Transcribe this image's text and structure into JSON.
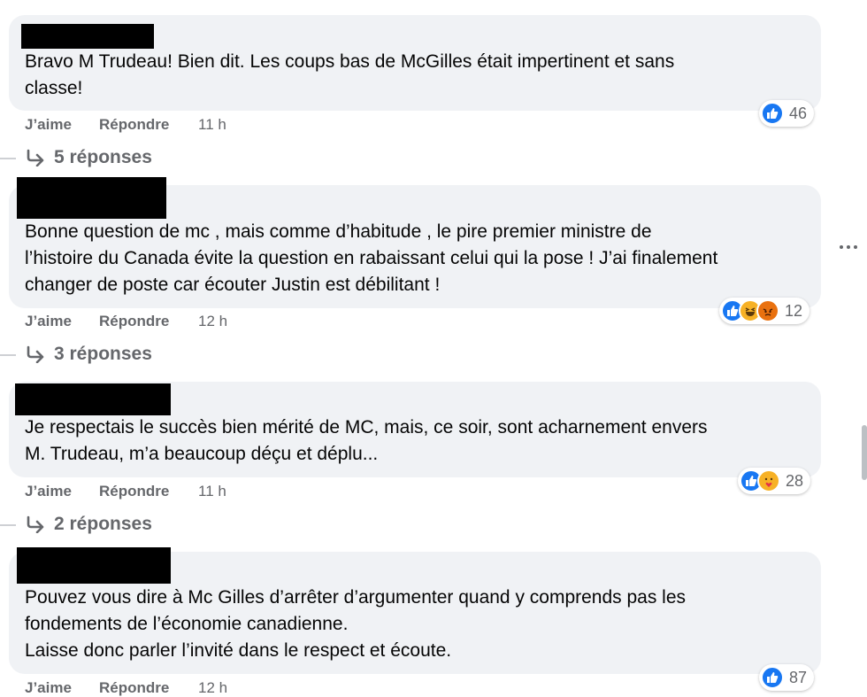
{
  "comments": [
    {
      "text_lines": [
        "Bravo M Trudeau! Bien dit. Les coups bas de McGilles était impertinent et sans",
        "classe!"
      ],
      "like_label": "J’aime",
      "reply_label": "Répondre",
      "time": "11 h",
      "reactions": [
        "like-icon"
      ],
      "reaction_count": "46",
      "replies": "5 réponses"
    },
    {
      "text_lines": [
        "Bonne question de mc , mais comme d’habitude , le pire premier ministre de",
        "l’histoire du Canada évite la question en rabaissant celui qui la pose ! J’ai finalement",
        "changer de poste car écouter Justin est débilitant !"
      ],
      "like_label": "J’aime",
      "reply_label": "Répondre",
      "time": "12 h",
      "reactions": [
        "like-icon",
        "haha-icon",
        "angry-icon"
      ],
      "reaction_count": "12",
      "replies": "3 réponses"
    },
    {
      "text_lines": [
        "Je respectais le succès bien mérité de MC, mais, ce soir, sont acharnement envers",
        "M. Trudeau, m’a beaucoup déçu et déplu..."
      ],
      "like_label": "J’aime",
      "reply_label": "Répondre",
      "time": "11 h",
      "reactions": [
        "like-icon",
        "care-icon"
      ],
      "reaction_count": "28",
      "replies": "2 réponses"
    },
    {
      "text_lines": [
        "Pouvez vous dire à Mc Gilles d’arrêter d’argumenter quand y comprends pas les",
        "fondements de l’économie canadienne.",
        "Laisse donc parler l’invité dans le respect et écoute."
      ],
      "like_label": "J’aime",
      "reply_label": "Répondre",
      "time": "12 h",
      "reactions": [
        "like-icon"
      ],
      "reaction_count": "87"
    }
  ],
  "colors": {
    "bubble": "#f0f2f5",
    "meta": "#65676b",
    "like": "#1877f2",
    "haha": "#f7b125",
    "angry": "#e9710f"
  },
  "icons": {
    "more": "more-options-icon",
    "reply_arrow": "reply-arrow-icon"
  }
}
